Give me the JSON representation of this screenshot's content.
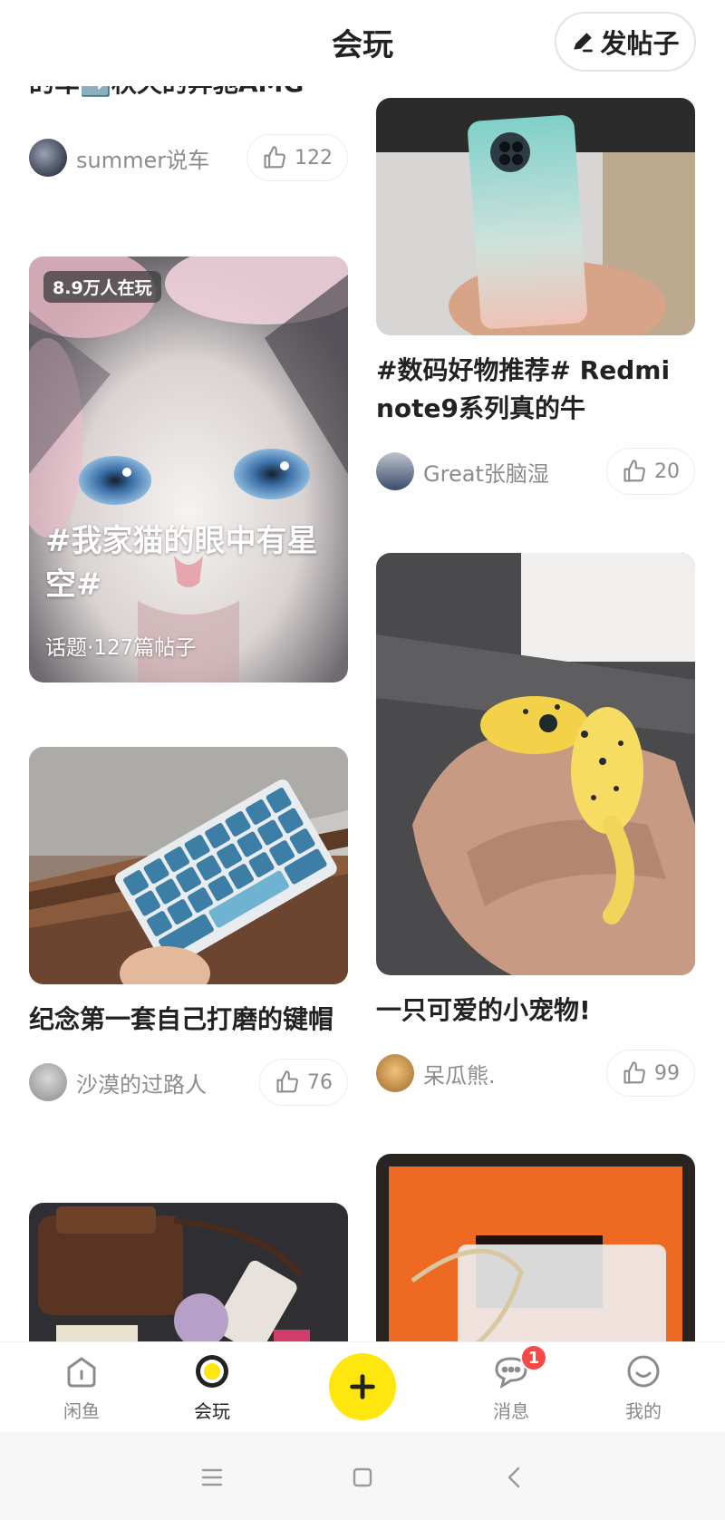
{
  "header": {
    "title": "会玩",
    "post_button_label": "发帖子"
  },
  "feed": {
    "left": [
      {
        "type": "post",
        "title_partial": "的车➡️秋天的奔驰AMG",
        "author": "summer说车",
        "likes": "122"
      },
      {
        "type": "topic",
        "badge": "8.9万人在玩",
        "title": "#我家猫的眼中有星空#",
        "subtitle": "话题·127篇帖子"
      },
      {
        "type": "post",
        "title": "纪念第一套自己打磨的键帽",
        "author": "沙漠的过路人",
        "likes": "76"
      }
    ],
    "right": [
      {
        "type": "post",
        "title": "#数码好物推荐# Redmi note9系列真的牛",
        "author": "Great张脑湿",
        "likes": "20"
      },
      {
        "type": "post",
        "title": "一只可爱的小宠物!",
        "author": "呆瓜熊.",
        "likes": "99"
      }
    ]
  },
  "tabbar": {
    "tabs": [
      {
        "label": "闲鱼",
        "icon": "home-icon",
        "active": false
      },
      {
        "label": "会玩",
        "icon": "circle-target-icon",
        "active": true
      },
      {
        "label": "",
        "icon": "plus-icon"
      },
      {
        "label": "消息",
        "icon": "chat-bubble-icon",
        "badge": "1"
      },
      {
        "label": "我的",
        "icon": "smiley-icon"
      }
    ]
  },
  "colors": {
    "accent": "#ffe60f",
    "badge": "#f54a45",
    "text": "#222222",
    "muted": "#8c8c8c"
  }
}
